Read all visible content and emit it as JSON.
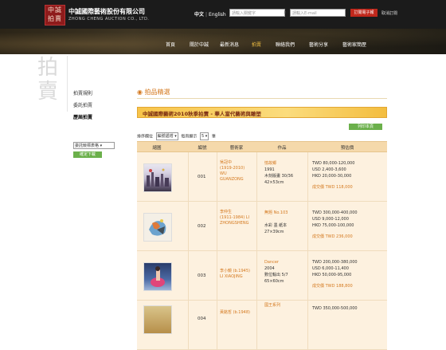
{
  "header": {
    "logo_text": "中誠 拍賣",
    "company_name": "中誠國際藝術股份有限公司",
    "company_name_en": "ZHONG CHENG AUCTION CO., LTD.",
    "lang_zh": "中文",
    "lang_sep": "|",
    "lang_en": "English",
    "search_placeholder": "請輸入關鍵字",
    "email_placeholder": "請輸入E-mail",
    "subscribe_label": "訂閱電子報",
    "unsubscribe_label": "取消訂閱"
  },
  "nav": {
    "items": [
      {
        "label": "首頁"
      },
      {
        "label": "關於中誠"
      },
      {
        "label": "最新消息"
      },
      {
        "label": "拍賣"
      },
      {
        "label": "聯絡我們"
      },
      {
        "label": "藝術分享"
      },
      {
        "label": "藝術家簡歷"
      }
    ]
  },
  "sidebar": {
    "big_char": "拍賣",
    "links": [
      {
        "label": "拍賣規則"
      },
      {
        "label": "委託拍賣"
      },
      {
        "label": "歷屆拍賣"
      }
    ],
    "select_value": "委託競標表格",
    "confirm_label": "確定下載"
  },
  "main": {
    "section_title": "拍品精選",
    "banner_title": "中誠國際藝術2010秋季拍賣 - 華人當代藝術與雕塑",
    "print_label": "列印本頁",
    "sort": {
      "label": "排序欄位",
      "value": "編號遞增",
      "per_page_label": "每頁顯示",
      "per_page_value": "5",
      "unit": "筆"
    },
    "table": {
      "headers": [
        "縮圖",
        "編號",
        "藝術家",
        "作品",
        "預估價"
      ],
      "rows": [
        {
          "lot": "001",
          "artist": [
            "吳冠中",
            "(1919-2010)",
            "WU",
            "GUANZONG"
          ],
          "work_title": "憶故鄉",
          "work": [
            "1991",
            "木刻版畫 30/36",
            "42×53cm"
          ],
          "estimates": [
            "TWD 80,000-120,000",
            "USD 2,400-3,600",
            "HKD 20,000-30,000"
          ],
          "sold": "成交價 TWD 118,000"
        },
        {
          "lot": "002",
          "artist": [
            "李仲生",
            "(1911-1984) LI",
            "ZHONGSHENG"
          ],
          "work_title": "無題 No.103",
          "work": [
            "",
            "水彩 墨 紙本",
            "27×39cm"
          ],
          "estimates": [
            "TWD 300,000-400,000",
            "USD 9,000-12,000",
            "HKD 75,000-100,000"
          ],
          "sold": "成交價 TWD 236,000"
        },
        {
          "lot": "003",
          "artist": [
            "李小鏡 (b.1945)",
            "LI XIAOJING"
          ],
          "work_title": "Dancer",
          "work": [
            "2004",
            "數位輸出 5/7",
            "65×60cm"
          ],
          "estimates": [
            "TWD 200,000-380,000",
            "USD 6,000-11,400",
            "HKD 50,000-95,000"
          ],
          "sold": "成交價 TWD 188,800"
        },
        {
          "lot": "004",
          "artist": [
            "黃銘哲 (b.1948)"
          ],
          "work_title": "國王系列",
          "work": [
            "",
            "",
            ""
          ],
          "estimates": [
            "TWD 350,000-500,000",
            "",
            ""
          ],
          "sold": ""
        }
      ]
    }
  },
  "colors": {
    "accent": "#d4791f",
    "banner": "#f7c44a",
    "header_bg": "#1b1b1b",
    "subscribe": "#c0281c",
    "button_green": "#6bb04b"
  }
}
